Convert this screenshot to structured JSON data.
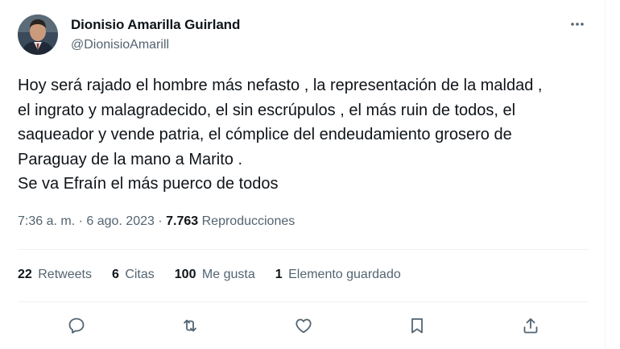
{
  "author": {
    "name": "Dionisio Amarilla Guirland",
    "handle": "@DionisioAmarill",
    "avatar_icon": "profile-photo"
  },
  "tweet": {
    "lines": [
      "Hoy será rajado el hombre más nefasto , la representación de la maldad ,",
      "el ingrato y malagradecido, el sin escrúpulos , el más ruin de todos, el",
      "saqueador y vende patria, el cómplice del endeudamiento grosero de",
      "Paraguay de la mano a Marito .",
      "Se va Efraín el más puerco de todos"
    ]
  },
  "meta": {
    "time": "7:36 a. m.",
    "sep1": " · ",
    "date": "6 ago. 2023",
    "sep2": " · ",
    "views_count": "7.763",
    "views_label": " Reproducciones"
  },
  "stats": {
    "retweets_count": "22",
    "retweets_label": "Retweets",
    "quotes_count": "6",
    "quotes_label": "Citas",
    "likes_count": "100",
    "likes_label": "Me gusta",
    "bookmarks_count": "1",
    "bookmarks_label": "Elemento guardado"
  },
  "actions": [
    "reply-icon",
    "retweet-icon",
    "like-icon",
    "bookmark-icon",
    "share-icon"
  ],
  "colors": {
    "text": "#0f1419",
    "secondary": "#536471",
    "divider": "#eff3f4"
  }
}
